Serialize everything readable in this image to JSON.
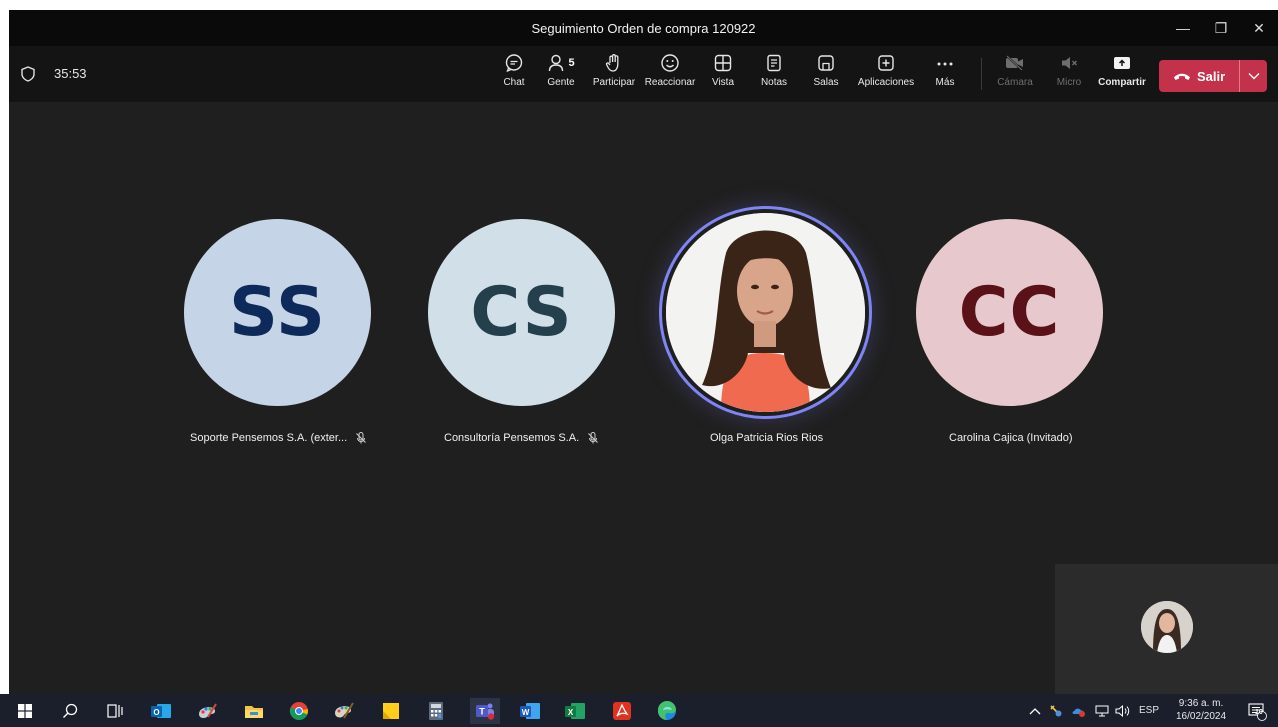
{
  "window": {
    "title": "Seguimiento Orden de compra 120922",
    "controls": {
      "minimize": "—",
      "maximize": "❐",
      "close": "✕"
    }
  },
  "meeting": {
    "timer": "35:53"
  },
  "toolbar": {
    "chat": "Chat",
    "people": "Gente",
    "people_count": "5",
    "raise": "Participar",
    "react": "Reaccionar",
    "view": "Vista",
    "notes": "Notas",
    "rooms": "Salas",
    "apps": "Aplicaciones",
    "more": "Más",
    "camera": "Cámara",
    "mic": "Micro",
    "share": "Compartir",
    "leave": "Salir"
  },
  "participants": [
    {
      "initials": "SS",
      "name": "Soporte Pensemos S.A. (exter...",
      "muted": true,
      "bg": "#c6d4e8",
      "fg": "#0e2a5a"
    },
    {
      "initials": "CS",
      "name": "Consultoría Pensemos S.A.",
      "muted": true,
      "bg": "#d0dfe8",
      "fg": "#24404d"
    },
    {
      "initials": "",
      "name": "Olga Patricia Rios Rios",
      "muted": false,
      "speaking": true
    },
    {
      "initials": "CC",
      "name": "Carolina Cajica (Invitado)",
      "muted": false,
      "bg": "#e7c8cc",
      "fg": "#5a1218"
    }
  ],
  "taskbar": {
    "lang": "ESP",
    "time": "9:36 a. m.",
    "date": "16/02/2024",
    "notifications": "10"
  },
  "colors": {
    "accent": "#7f85f5",
    "leave": "#c4314b",
    "stage": "#1f1f1f"
  }
}
